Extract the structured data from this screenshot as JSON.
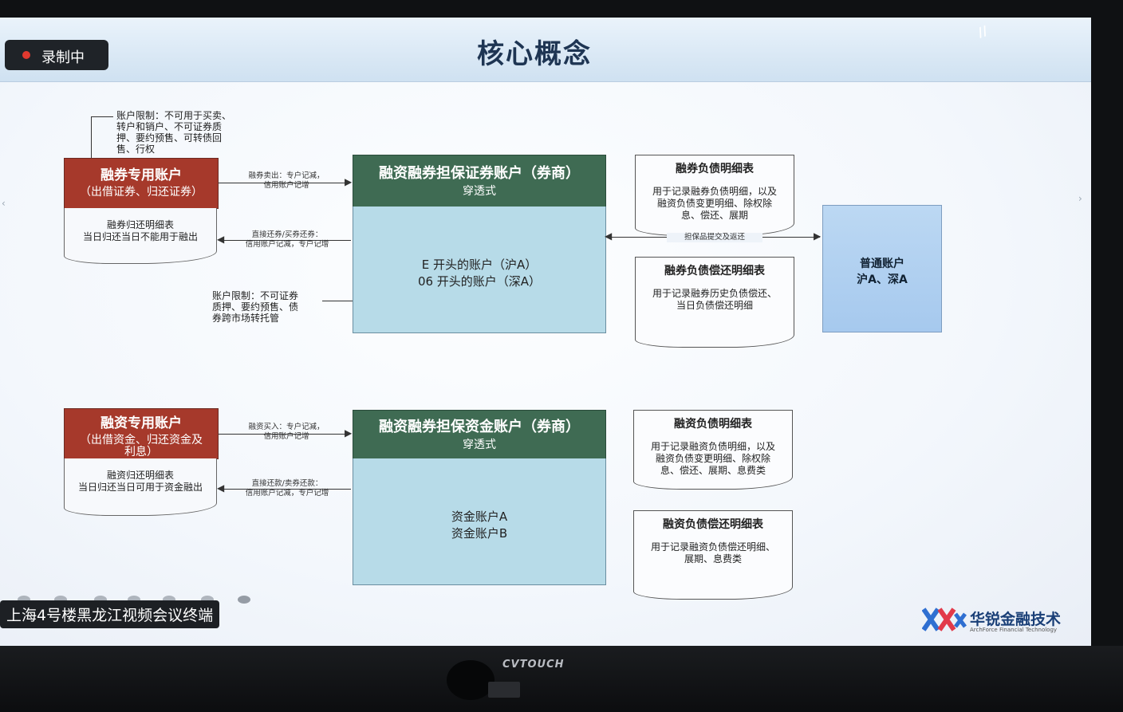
{
  "slide": {
    "title": "核心概念",
    "recording_label": "录制中",
    "terminal_label": "上海4号楼黑龙江视频会议终端",
    "monitor_brand": "CVTOUCH",
    "logo": {
      "name": "华锐金融技术",
      "english": "ArchForce Financial Technology"
    }
  },
  "securities_section": {
    "special_account": {
      "title": "融券专用账户",
      "subtitle": "（出借证券、归还证券）"
    },
    "special_doc": {
      "line1": "融券归还明细表",
      "line2": "当日归还当日不能用于融出"
    },
    "restriction_top": [
      "账户限制：不可用于买卖、",
      "转户和销户、不可证券质",
      "押、要约预售、可转债回",
      "售、行权"
    ],
    "arrow_right_label": [
      "融券卖出：专户记减，",
      "信用账户记增"
    ],
    "arrow_left_label": [
      "直接还券/买券还券：",
      "信用账户记减，专户记增"
    ],
    "restriction_bottom": [
      "账户限制：不可证券",
      "质押、要约预售、债",
      "券跨市场转托管"
    ],
    "collateral_account": {
      "title": "融资融券担保证券账户（券商）",
      "subtitle": "穿透式",
      "line1": "E 开头的账户（沪A）",
      "line2": "06 开头的账户（深A）"
    },
    "debt_doc": {
      "title": "融券负债明细表",
      "desc": [
        "用于记录融券负债明细，以及",
        "融资负债变更明细、除权除",
        "息、偿还、展期"
      ]
    },
    "repay_doc": {
      "title": "融券负债偿还明细表",
      "desc": [
        "用于记录融券历史负债偿还、",
        "当日负债偿还明细"
      ]
    },
    "transfer_label": "担保品提交及返还",
    "normal_account": {
      "title": "普通账户",
      "subtitle": "沪A、深A"
    }
  },
  "finance_section": {
    "special_account": {
      "title": "融资专用账户",
      "subtitle": "（出借资金、归还资金及",
      "subtitle2": "利息）"
    },
    "special_doc": {
      "line1": "融资归还明细表",
      "line2": "当日归还当日可用于资金融出"
    },
    "arrow_right_label": [
      "融资买入：专户记减，",
      "信用账户记增"
    ],
    "arrow_left_label": [
      "直接还款/卖券还款：",
      "信用账户记减，专户记增"
    ],
    "collateral_account": {
      "title": "融资融券担保资金账户（券商）",
      "subtitle": "穿透式",
      "line1": "资金账户A",
      "line2": "资金账户B"
    },
    "debt_doc": {
      "title": "融资负债明细表",
      "desc": [
        "用于记录融资负债明细，以及",
        "融资负债变更明细、除权除",
        "息、偿还、展期、息费类"
      ]
    },
    "repay_doc": {
      "title": "融资负债偿还明细表",
      "desc": [
        "用于记录融资负债偿还明细、",
        "展期、息费类"
      ]
    }
  },
  "colors": {
    "red_header": "#a6392b",
    "green_header": "#3f6b53",
    "blue_body": "#b7dbe8",
    "title_color": "#1e3553"
  }
}
